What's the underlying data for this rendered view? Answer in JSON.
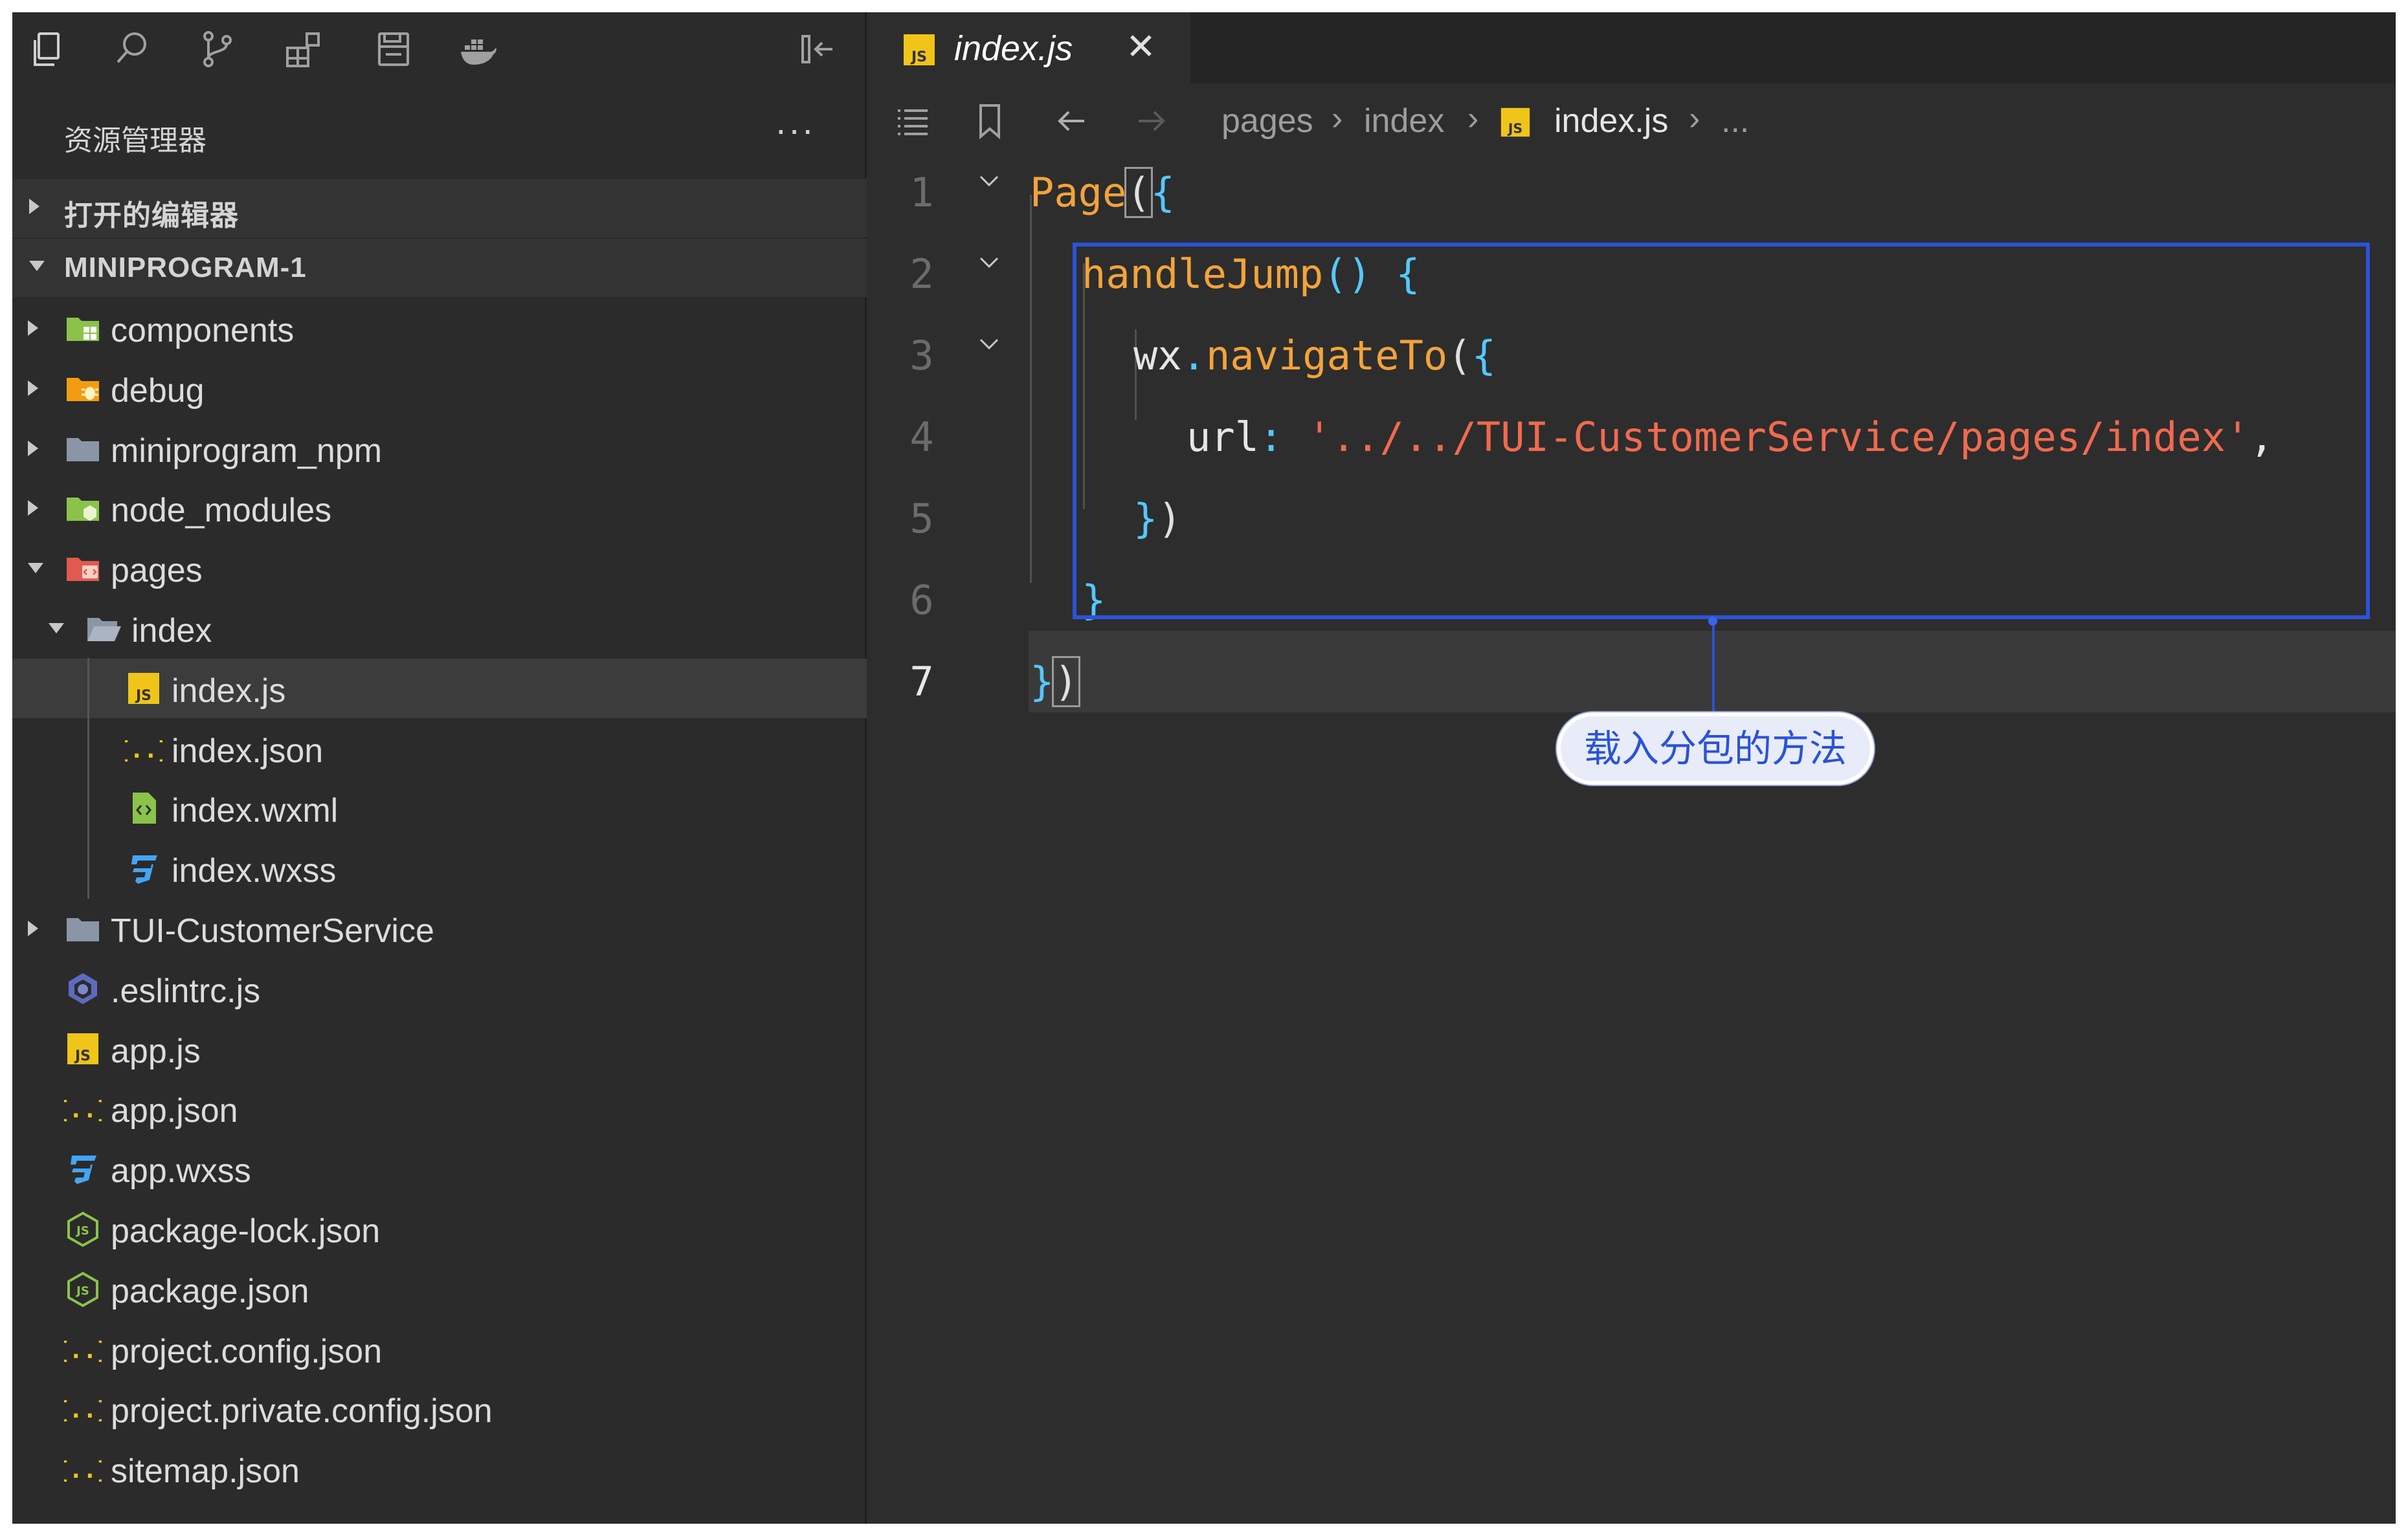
{
  "activity_bar": {
    "icons": [
      "explorer-icon",
      "search-icon",
      "source-control-icon",
      "extensions-icon",
      "save-icon",
      "docker-icon",
      "collapse-sidebar-icon"
    ]
  },
  "explorer": {
    "title": "资源管理器",
    "more": "···",
    "open_editors_label": "打开的编辑器",
    "project_label": "MINIPROGRAM-1",
    "tree": [
      {
        "name": "components",
        "icon": "components-folder-icon"
      },
      {
        "name": "debug",
        "icon": "debug-folder-icon"
      },
      {
        "name": "miniprogram_npm",
        "icon": "folder-icon"
      },
      {
        "name": "node_modules",
        "icon": "node-modules-folder-icon"
      },
      {
        "name": "pages",
        "icon": "pages-folder-icon"
      },
      {
        "name": "index",
        "icon": "open-folder-icon"
      },
      {
        "name": "index.js",
        "icon": "js-file-icon"
      },
      {
        "name": "index.json",
        "icon": "json-file-icon"
      },
      {
        "name": "index.wxml",
        "icon": "wxml-file-icon"
      },
      {
        "name": "index.wxss",
        "icon": "css-file-icon"
      },
      {
        "name": "TUI-CustomerService",
        "icon": "folder-icon"
      },
      {
        "name": ".eslintrc.js",
        "icon": "eslint-file-icon"
      },
      {
        "name": "app.js",
        "icon": "js-file-icon"
      },
      {
        "name": "app.json",
        "icon": "json-file-icon"
      },
      {
        "name": "app.wxss",
        "icon": "css-file-icon"
      },
      {
        "name": "package-lock.json",
        "icon": "node-file-icon"
      },
      {
        "name": "package.json",
        "icon": "node-file-icon"
      },
      {
        "name": "project.config.json",
        "icon": "json-file-icon"
      },
      {
        "name": "project.private.config.json",
        "icon": "json-file-icon"
      },
      {
        "name": "sitemap.json",
        "icon": "json-file-icon"
      }
    ]
  },
  "tab": {
    "title": "index.js",
    "close": "✕",
    "icon": "js-file-icon"
  },
  "breadcrumb": {
    "parts": [
      "pages",
      "index",
      "index.js",
      "..."
    ],
    "sep": "›"
  },
  "code": {
    "line_numbers": [
      "1",
      "2",
      "3",
      "4",
      "5",
      "6",
      "7"
    ],
    "l1": {
      "fn": "Page",
      "p": "(",
      "b": "{"
    },
    "l2": {
      "fn": "handleJump",
      "p": "()",
      "b": "{"
    },
    "l3": {
      "obj": "wx",
      "dot": ".",
      "fn": "navigateTo",
      "p": "(",
      "b": "{"
    },
    "l4": {
      "key": "url",
      "colon": ":",
      "str": "'../../TUI-CustomerService/pages/index'",
      "comma": ","
    },
    "l5": {
      "b": "}",
      "p": ")"
    },
    "l6": {
      "b": "}"
    },
    "l7": {
      "b": "}",
      "p": ")"
    }
  },
  "annotation": {
    "label": "载入分包的方法",
    "color": "#2a53d8"
  },
  "colors": {
    "background": "#2d2d2d",
    "sidebar": "#2b2b2b",
    "function": "#f3a33a",
    "brace": "#54c8ff",
    "string": "#f06a4f"
  }
}
